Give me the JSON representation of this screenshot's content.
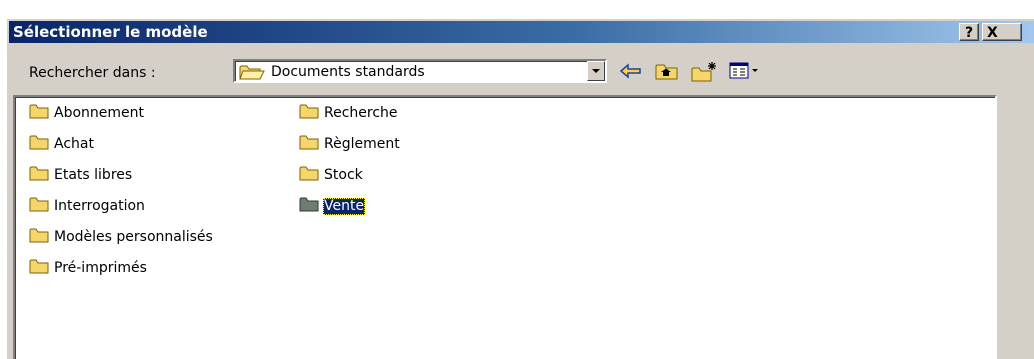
{
  "window": {
    "title": "Sélectionner le modèle",
    "help_label": "?",
    "close_label": "X"
  },
  "toolbar": {
    "lookin_label": "Rechercher dans :",
    "lookin_value": "Documents standards",
    "icons": [
      "back-arrow-icon",
      "up-folder-icon",
      "new-folder-icon",
      "view-menu-icon"
    ]
  },
  "colors": {
    "folder_yellow": "#f5d66b",
    "selected_bg": "#0a246a",
    "titlebar_start": "#0a246a"
  },
  "files": {
    "column1": [
      {
        "label": "Abonnement"
      },
      {
        "label": "Achat"
      },
      {
        "label": "Etats libres"
      },
      {
        "label": "Interrogation"
      },
      {
        "label": "Modèles personnalisés"
      },
      {
        "label": "Pré-imprimés"
      }
    ],
    "column2": [
      {
        "label": "Recherche"
      },
      {
        "label": "Règlement"
      },
      {
        "label": "Stock"
      },
      {
        "label": "Vente",
        "selected": true
      }
    ]
  }
}
